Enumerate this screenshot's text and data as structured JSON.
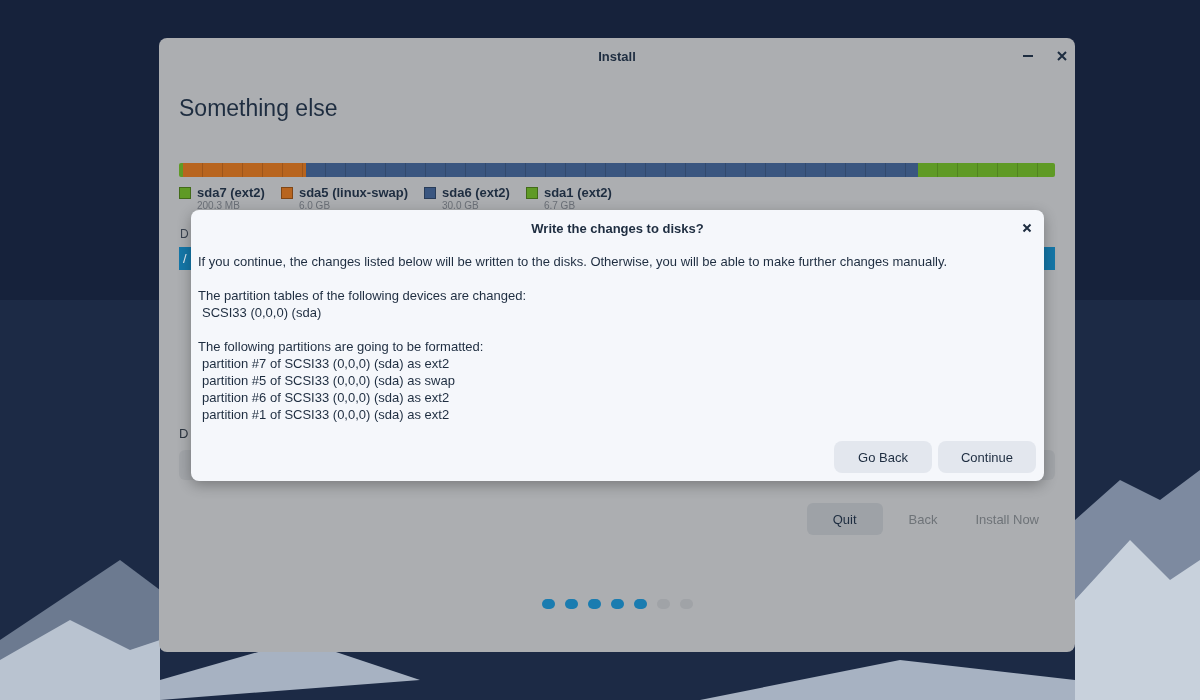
{
  "window": {
    "title": "Install"
  },
  "page": {
    "title": "Something else"
  },
  "partitions": [
    {
      "name": "sda7 (ext2)",
      "size": "200.3 MB",
      "color": "#5f9a25"
    },
    {
      "name": "sda5 (linux-swap)",
      "size": "6.0 GB",
      "color": "#b8651f"
    },
    {
      "name": "sda6 (ext2)",
      "size": "30.0 GB",
      "color": "#3a5680"
    },
    {
      "name": "sda1 (ext2)",
      "size": "6.7 GB",
      "color": "#5f9a25"
    }
  ],
  "partition_list": {
    "label": "D",
    "rows": [
      {
        "text": "/",
        "selected": true
      }
    ]
  },
  "device_label": "D",
  "buttons": [
    {
      "label": "Quit",
      "disabled": false
    },
    {
      "label": "Back",
      "disabled": true
    },
    {
      "label": "Install Now",
      "disabled": true
    }
  ],
  "steps": [
    {
      "done": true
    },
    {
      "done": true
    },
    {
      "done": true
    },
    {
      "done": true
    },
    {
      "done": true
    },
    {
      "done": false
    },
    {
      "done": false
    }
  ],
  "dialog": {
    "title": "Write the changes to disks?",
    "intro": "If you continue, the changes listed below will be written to the disks. Otherwise, you will be able to make further changes manually.",
    "sections": [
      {
        "heading": "The partition tables of the following devices are changed:",
        "items": [
          "SCSI33 (0,0,0) (sda)"
        ]
      },
      {
        "heading": "The following partitions are going to be formatted:",
        "items": [
          "partition #7 of SCSI33 (0,0,0) (sda) as ext2",
          "partition #5 of SCSI33 (0,0,0) (sda) as swap",
          "partition #6 of SCSI33 (0,0,0) (sda) as ext2",
          "partition #1 of SCSI33 (0,0,0) (sda) as ext2"
        ]
      }
    ],
    "buttons": [
      {
        "label": "Go Back"
      },
      {
        "label": "Continue"
      }
    ]
  }
}
